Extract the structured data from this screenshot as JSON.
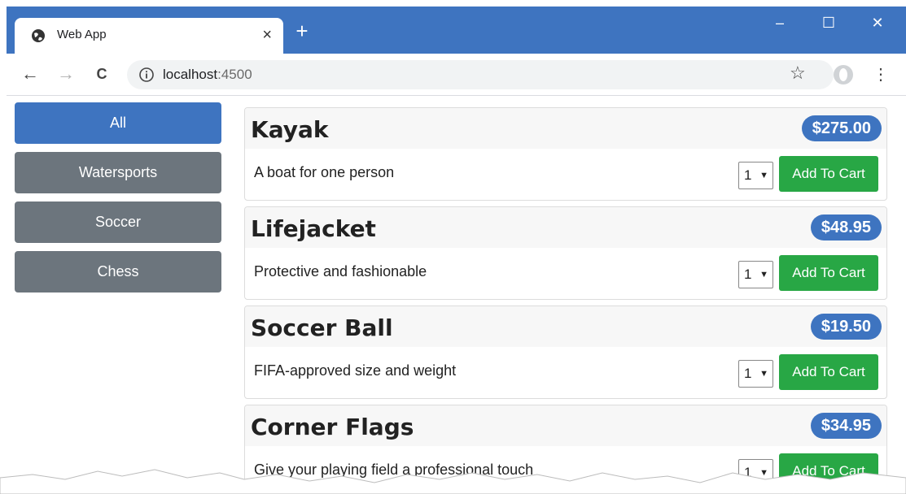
{
  "browser": {
    "tab_title": "Web App",
    "tab_close": "×",
    "new_tab": "+",
    "url_host": "localhost",
    "url_port": ":4500",
    "minimize": "–",
    "maximize": "☐",
    "close": "✕",
    "back": "←",
    "forward": "→",
    "reload": "C",
    "star": "☆",
    "menu": "⋮",
    "accent_color": "#3e74c0"
  },
  "sidebar": {
    "items": [
      {
        "label": "All",
        "active": true
      },
      {
        "label": "Watersports",
        "active": false
      },
      {
        "label": "Soccer",
        "active": false
      },
      {
        "label": "Chess",
        "active": false
      }
    ]
  },
  "products": [
    {
      "name": "Kayak",
      "price": "$275.00",
      "description": "A boat for one person",
      "quantity": "1",
      "button": "Add To Cart"
    },
    {
      "name": "Lifejacket",
      "price": "$48.95",
      "description": "Protective and fashionable",
      "quantity": "1",
      "button": "Add To Cart"
    },
    {
      "name": "Soccer Ball",
      "price": "$19.50",
      "description": "FIFA-approved size and weight",
      "quantity": "1",
      "button": "Add To Cart"
    },
    {
      "name": "Corner Flags",
      "price": "$34.95",
      "description": "Give your playing field a professional touch",
      "quantity": "1",
      "button": "Add To Cart"
    }
  ],
  "colors": {
    "primary": "#3e74c0",
    "secondary": "#6c757d",
    "success": "#28a745"
  }
}
